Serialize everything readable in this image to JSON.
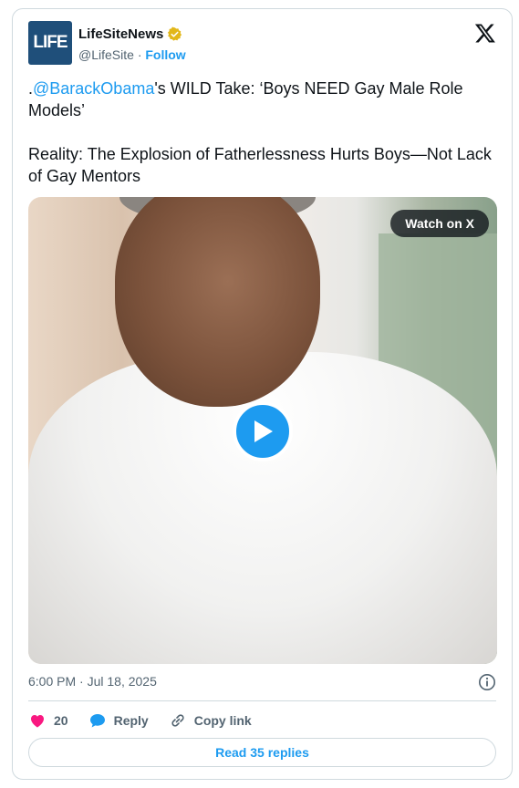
{
  "author": {
    "logo_text": "LIFE",
    "name": "LifeSiteNews",
    "handle": "@LifeSite",
    "separator": "·",
    "follow_label": "Follow"
  },
  "tweet": {
    "prefix": ".",
    "mention": "@BarackObama",
    "line1_rest": "'s WILD Take: ‘Boys NEED Gay Male Role Models’",
    "line2": "Reality: The Explosion of Fatherlessness Hurts Boys—Not Lack of Gay Mentors"
  },
  "media": {
    "watch_label": "Watch on X"
  },
  "meta": {
    "timestamp": "6:00 PM · Jul 18, 2025"
  },
  "actions": {
    "like_count": "20",
    "reply_label": "Reply",
    "copy_label": "Copy link"
  },
  "footer": {
    "read_replies_label": "Read 35 replies"
  },
  "colors": {
    "accent": "#1d9bf0",
    "like": "#f91880",
    "verified": "#e2b719",
    "logo_bg": "#1f4f7a"
  }
}
